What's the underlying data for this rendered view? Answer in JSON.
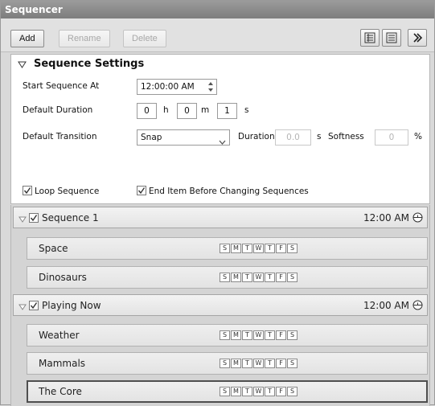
{
  "window": {
    "title": "Sequencer"
  },
  "toolbar": {
    "add_label": "Add",
    "rename_label": "Rename",
    "delete_label": "Delete",
    "icons": [
      "list-view-icon",
      "detail-view-icon",
      "expand-panel-icon"
    ]
  },
  "settings": {
    "title": "Sequence Settings",
    "start_label": "Start Sequence At",
    "start_value": "12:00:00 AM",
    "default_duration_label": "Default Duration",
    "hours_value": "0",
    "hours_unit": "h",
    "minutes_value": "0",
    "minutes_unit": "m",
    "seconds_value": "1",
    "seconds_unit": "s",
    "transition_label": "Default Transition",
    "transition_value": "Snap",
    "duration_label": "Duration",
    "duration_value": "0.0",
    "duration_unit": "s",
    "softness_label": "Softness",
    "softness_value": "0",
    "softness_unit": "%",
    "loop_label": "Loop Sequence",
    "loop_checked": true,
    "end_item_label": "End Item Before Changing Sequences",
    "end_item_checked": true
  },
  "days": [
    "S",
    "M",
    "T",
    "W",
    "T",
    "F",
    "S"
  ],
  "sequences": [
    {
      "name": "Sequence 1",
      "time": "12:00 AM",
      "checked": true,
      "items": [
        "Space",
        "Dinosaurs"
      ]
    },
    {
      "name": "Playing Now",
      "time": "12:00 AM",
      "checked": true,
      "items": [
        "Weather",
        "Mammals",
        "The Core"
      ]
    }
  ],
  "selected_item": "The Core"
}
